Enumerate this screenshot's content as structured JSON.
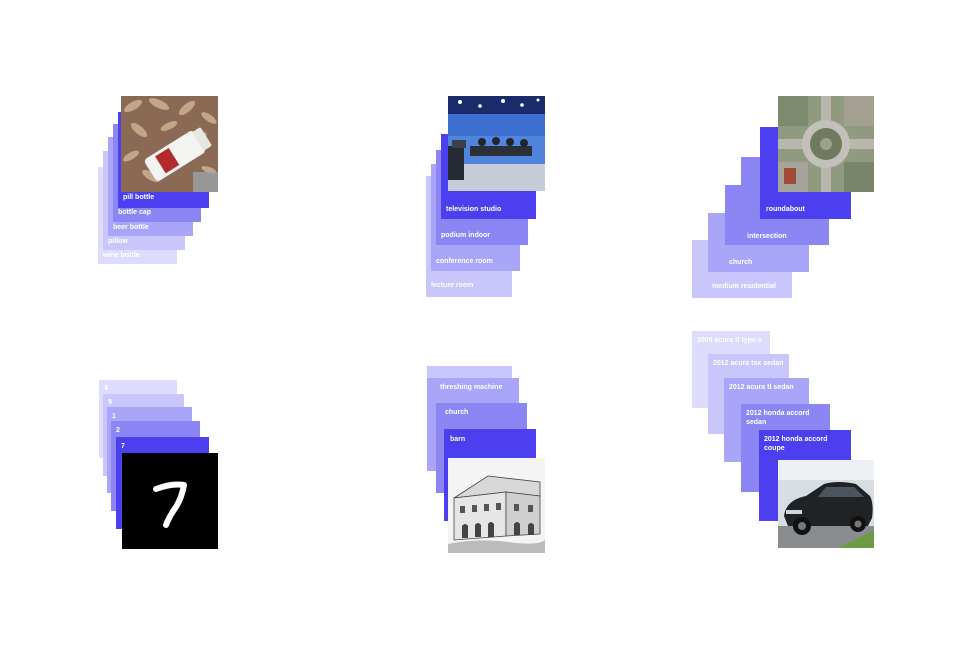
{
  "colors": {
    "l1": "#4c3fef",
    "l2": "#6f67f3",
    "l3": "#8c86f5",
    "l4": "#a9a5f8",
    "l5": "#c9c6fb",
    "l6": "#dedcfd"
  },
  "panels": [
    {
      "id": "pill",
      "image": "pill-bottle-photo",
      "labels": [
        "pill bottle",
        "bottle cap",
        "beer bottle",
        "pillow",
        "wine bottle"
      ]
    },
    {
      "id": "studio",
      "image": "television-studio-photo",
      "labels": [
        "television studio",
        "podium indoor",
        "conference room",
        "lecture room"
      ]
    },
    {
      "id": "round",
      "image": "roundabout-aerial-photo",
      "labels": [
        "roundabout",
        "intersection",
        "church",
        "medium residential"
      ]
    },
    {
      "id": "digit",
      "image": "handwritten-digit-seven",
      "labels": [
        "7",
        "2",
        "1",
        "9",
        "4"
      ]
    },
    {
      "id": "barn",
      "image": "barn-sketch",
      "labels": [
        "barn",
        "church",
        "threshing machine"
      ]
    },
    {
      "id": "car",
      "image": "honda-accord-photo",
      "labels": [
        "2012 honda accord coupe",
        "2012 honda accord sedan",
        "2012 acura tl sedan",
        "2012 acura tsx sedan",
        "2006 acura tl type-s"
      ]
    }
  ]
}
